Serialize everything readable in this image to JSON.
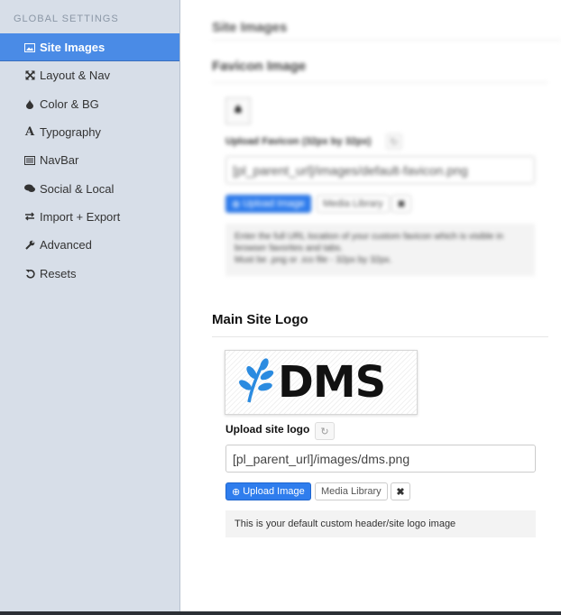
{
  "sidebar": {
    "heading": "GLOBAL SETTINGS",
    "items": [
      {
        "label": "Site Images",
        "icon": "image-icon",
        "active": true
      },
      {
        "label": "Layout & Nav",
        "icon": "expand-arrows-icon"
      },
      {
        "label": "Color & BG",
        "icon": "drop-icon"
      },
      {
        "label": "Typography",
        "icon": "font-icon"
      },
      {
        "label": "NavBar",
        "icon": "list-icon"
      },
      {
        "label": "Social & Local",
        "icon": "comments-icon"
      },
      {
        "label": "Import + Export",
        "icon": "exchange-icon"
      },
      {
        "label": "Advanced",
        "icon": "wrench-icon"
      },
      {
        "label": "Resets",
        "icon": "undo-icon"
      }
    ]
  },
  "main": {
    "page_title": "Site Images",
    "favicon": {
      "title": "Favicon Image",
      "upload_label": "Upload Favicon (32px by 32px)",
      "input_value": "[pl_parent_url]/images/default-favicon.png",
      "upload_button": "Upload Image",
      "library_button": "Media Library",
      "help_line1": "Enter the full URL location of your custom favicon which is visible in browser favorites and tabs.",
      "help_line2": "Must be .png or .ico file - 32px by 32px."
    },
    "logo": {
      "title": "Main Site Logo",
      "logo_text": "DMS",
      "upload_label": "Upload site logo",
      "input_value": "[pl_parent_url]/images/dms.png",
      "upload_button": "Upload Image",
      "library_button": "Media Library",
      "remove_glyph": "✖",
      "help_text": "This is your default custom header/site logo image"
    }
  },
  "colors": {
    "sidebar_bg": "#d7dee8",
    "active_item": "#4a8be6",
    "primary_button": "#2f7ded",
    "logo_leaf": "#2b8be0"
  }
}
